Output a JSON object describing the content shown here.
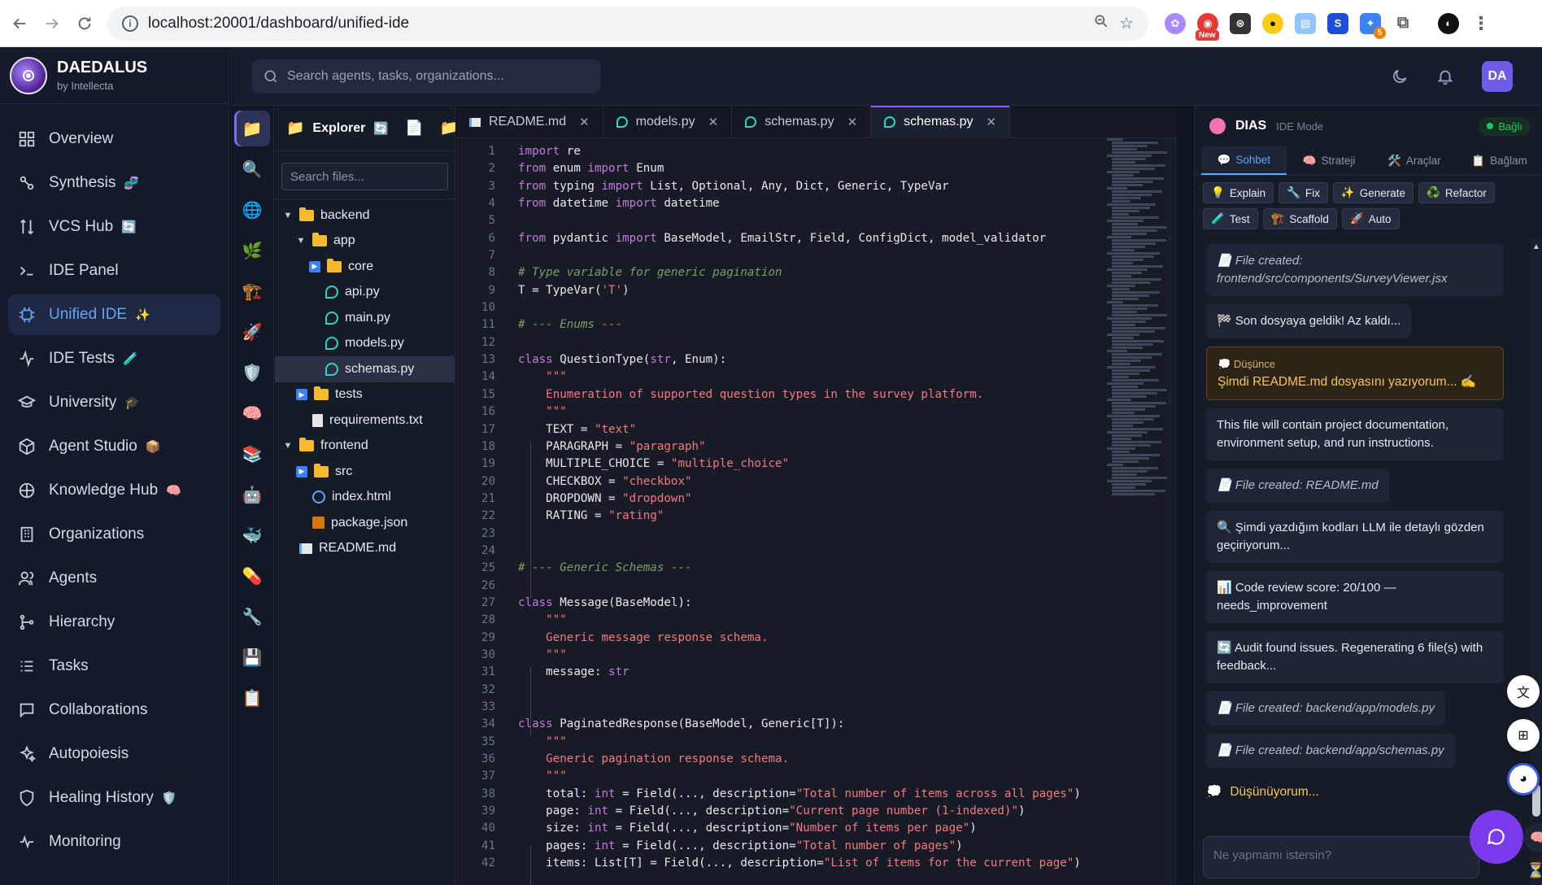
{
  "browser": {
    "url": "localhost:20001/dashboard/unified-ide",
    "ext_new_badge": "New",
    "ext_count": "5"
  },
  "brand": {
    "name": "DAEDALUS",
    "sub": "by Intellecta"
  },
  "nav": {
    "items": [
      {
        "label": "Overview",
        "icon": "grid-icon",
        "emoji": ""
      },
      {
        "label": "Synthesis",
        "icon": "synthesis-icon",
        "emoji": "🧬"
      },
      {
        "label": "VCS Hub",
        "icon": "vcs-icon",
        "emoji": "🔄"
      },
      {
        "label": "IDE Panel",
        "icon": "terminal-icon",
        "emoji": ""
      },
      {
        "label": "Unified IDE",
        "icon": "cpu-icon",
        "emoji": "✨"
      },
      {
        "label": "IDE Tests",
        "icon": "activity-icon",
        "emoji": "🧪"
      },
      {
        "label": "University",
        "icon": "graduation-icon",
        "emoji": "🎓"
      },
      {
        "label": "Agent Studio",
        "icon": "cube-icon",
        "emoji": "📦"
      },
      {
        "label": "Knowledge Hub",
        "icon": "brain-icon",
        "emoji": "🧠"
      },
      {
        "label": "Organizations",
        "icon": "building-icon",
        "emoji": ""
      },
      {
        "label": "Agents",
        "icon": "users-icon",
        "emoji": ""
      },
      {
        "label": "Hierarchy",
        "icon": "hierarchy-icon",
        "emoji": ""
      },
      {
        "label": "Tasks",
        "icon": "tasks-icon",
        "emoji": ""
      },
      {
        "label": "Collaborations",
        "icon": "chat-icon",
        "emoji": ""
      },
      {
        "label": "Autopoiesis",
        "icon": "sparkles-icon",
        "emoji": ""
      },
      {
        "label": "Healing History",
        "icon": "shield-icon",
        "emoji": "🛡️"
      },
      {
        "label": "Monitoring",
        "icon": "pulse-icon",
        "emoji": ""
      }
    ]
  },
  "header": {
    "search_placeholder": "Search agents, tasks, organizations...",
    "avatar": "DA"
  },
  "activity": [
    "📁",
    "🔍",
    "🌐",
    "🌿",
    "🏗️",
    "🚀",
    "🛡️",
    "🧠",
    "📚",
    "🤖",
    "🐳",
    "💊",
    "🔧",
    "💾",
    "📋"
  ],
  "explorer": {
    "title": "Explorer",
    "search_placeholder": "Search files...",
    "tree": [
      {
        "label": "backend",
        "kind": "folder-open",
        "depth": 0
      },
      {
        "label": "app",
        "kind": "folder-open",
        "depth": 1
      },
      {
        "label": "core",
        "kind": "folder-closed",
        "depth": 2
      },
      {
        "label": "api.py",
        "kind": "py",
        "depth": 2
      },
      {
        "label": "main.py",
        "kind": "py",
        "depth": 2
      },
      {
        "label": "models.py",
        "kind": "py",
        "depth": 2
      },
      {
        "label": "schemas.py",
        "kind": "py",
        "depth": 2,
        "selected": true
      },
      {
        "label": "tests",
        "kind": "folder-closed",
        "depth": 1
      },
      {
        "label": "requirements.txt",
        "kind": "file",
        "depth": 1
      },
      {
        "label": "frontend",
        "kind": "folder-open",
        "depth": 0
      },
      {
        "label": "src",
        "kind": "folder-closed",
        "depth": 1
      },
      {
        "label": "index.html",
        "kind": "html",
        "depth": 1
      },
      {
        "label": "package.json",
        "kind": "pkg",
        "depth": 1
      },
      {
        "label": "README.md",
        "kind": "md",
        "depth": 0
      }
    ]
  },
  "tabs": [
    {
      "label": "README.md",
      "kind": "md"
    },
    {
      "label": "models.py",
      "kind": "py"
    },
    {
      "label": "schemas.py",
      "kind": "py"
    },
    {
      "label": "schemas.py",
      "kind": "py",
      "active": true
    }
  ],
  "code": [
    "import re",
    "from enum import Enum",
    "from typing import List, Optional, Any, Dict, Generic, TypeVar",
    "from datetime import datetime",
    "",
    "from pydantic import BaseModel, EmailStr, Field, ConfigDict, model_validator",
    "",
    "# Type variable for generic pagination",
    "T = TypeVar('T')",
    "",
    "# --- Enums ---",
    "",
    "class QuestionType(str, Enum):",
    "    \"\"\"",
    "    Enumeration of supported question types in the survey platform.",
    "    \"\"\"",
    "    TEXT = \"text\"",
    "    PARAGRAPH = \"paragraph\"",
    "    MULTIPLE_CHOICE = \"multiple_choice\"",
    "    CHECKBOX = \"checkbox\"",
    "    DROPDOWN = \"dropdown\"",
    "    RATING = \"rating\"",
    "",
    "",
    "# --- Generic Schemas ---",
    "",
    "class Message(BaseModel):",
    "    \"\"\"",
    "    Generic message response schema.",
    "    \"\"\"",
    "    message: str",
    "",
    "",
    "class PaginatedResponse(BaseModel, Generic[T]):",
    "    \"\"\"",
    "    Generic pagination response schema.",
    "    \"\"\"",
    "    total: int = Field(..., description=\"Total number of items across all pages\")",
    "    page: int = Field(..., description=\"Current page number (1-indexed)\")",
    "    size: int = Field(..., description=\"Number of items per page\")",
    "    pages: int = Field(..., description=\"Total number of pages\")",
    "    items: List[T] = Field(..., description=\"List of items for the current page\")"
  ],
  "dias": {
    "title": "DIAS",
    "mode": "IDE Mode",
    "status": "Bağlı",
    "tabs": [
      {
        "label": "Sohbet",
        "icon": "💬",
        "active": true
      },
      {
        "label": "Strateji",
        "icon": "🧠"
      },
      {
        "label": "Araçlar",
        "icon": "🛠️"
      },
      {
        "label": "Bağlam",
        "icon": "📋"
      }
    ],
    "actions": [
      {
        "label": "Explain",
        "icon": "💡"
      },
      {
        "label": "Fix",
        "icon": "🔧"
      },
      {
        "label": "Generate",
        "icon": "✨"
      },
      {
        "label": "Refactor",
        "icon": "♻️"
      },
      {
        "label": "Test",
        "icon": "🧪"
      },
      {
        "label": "Scaffold",
        "icon": "🏗️"
      },
      {
        "label": "Auto",
        "icon": "🚀"
      }
    ],
    "messages": [
      {
        "kind": "file",
        "icon": "📄",
        "text": "File created: frontend/src/components/SurveyViewer.jsx"
      },
      {
        "kind": "inline",
        "icon": "🏁",
        "text": "Son dosyaya geldik! Az kaldı..."
      },
      {
        "kind": "think",
        "icon": "💭",
        "label": "Düşünce",
        "text": "Şimdi README.md dosyasını yazıyorum... ✍️"
      },
      {
        "kind": "plain",
        "icon": "",
        "text": "This file will contain project documentation, environment setup, and run instructions."
      },
      {
        "kind": "file-inline",
        "icon": "📄",
        "text": "File created: README.md"
      },
      {
        "kind": "plain",
        "icon": "🔍",
        "text": "Şimdi yazdığım kodları LLM ile detaylı gözden geçiriyorum..."
      },
      {
        "kind": "plain",
        "icon": "📊",
        "text": "Code review score: 20/100 — needs_improvement"
      },
      {
        "kind": "plain",
        "icon": "🔄",
        "text": "Audit found issues. Regenerating 6 file(s) with feedback..."
      },
      {
        "kind": "file-inline",
        "icon": "📄",
        "text": "File created: backend/app/models.py"
      },
      {
        "kind": "file-inline",
        "icon": "📄",
        "text": "File created: backend/app/schemas.py"
      }
    ],
    "thinking": "Düşünüyorum...",
    "input_placeholder": "Ne yapmamı istersin?"
  }
}
